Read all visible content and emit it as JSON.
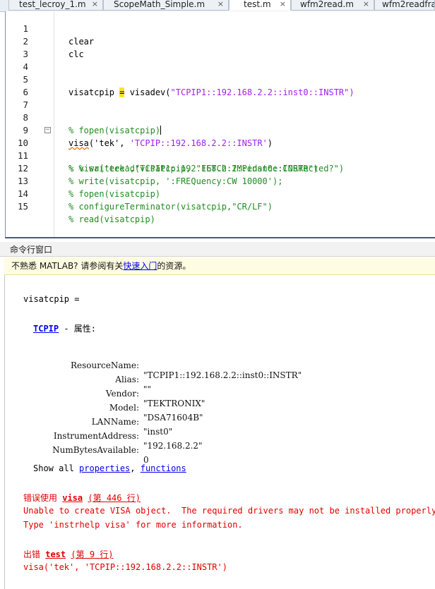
{
  "tabs": [
    {
      "label": "test_lecroy_1.m",
      "close": "×"
    },
    {
      "label": "ScopeMath_Simple.m",
      "close": "×"
    },
    {
      "label": "test.m",
      "close": "×"
    },
    {
      "label": "wfm2read.m",
      "close": "×"
    },
    {
      "label": "wfm2readfra",
      "close": ""
    }
  ],
  "editor": {
    "lines": [
      {
        "n": "1",
        "a": "clear",
        "b": "",
        "c": "",
        "d": ""
      },
      {
        "n": "2",
        "a": "clc",
        "b": "",
        "c": "",
        "d": ""
      },
      {
        "n": "3",
        "a": "",
        "b": "",
        "c": "",
        "d": ""
      },
      {
        "n": "4",
        "a": "",
        "b": "",
        "c": "",
        "d": ""
      },
      {
        "n": "5",
        "a": "visatcpip ",
        "b": "=",
        "c": " visadev(",
        "d": "\"TCPIP1::192.168.2.2::inst0::INSTR\")"
      },
      {
        "n": "6",
        "a": "",
        "b": "",
        "c": "",
        "d": ""
      },
      {
        "n": "7",
        "a": "",
        "b": "",
        "c": "",
        "d": ""
      },
      {
        "n": "8",
        "a": "% fopen(visatcpip)",
        "b": "",
        "c": "",
        "d": ""
      },
      {
        "n": "9",
        "a": "visa",
        "b": "('tek', ",
        "c": "'TCPIP::192.168.2.2::INSTR'",
        "d": ")"
      },
      {
        "n": "10",
        "a": "% visa('tek',\"TCPIP1::192.168.2.2::inst0::INSTR\")",
        "b": "",
        "c": "",
        "d": ""
      },
      {
        "n": "11",
        "a": "% % writeread(visatcpip, \"FETCh:IMPedance:CORRected?\")",
        "b": "",
        "c": "",
        "d": ""
      },
      {
        "n": "12",
        "a": "% write(visatcpip, ':FREQuency:CW 10000');",
        "b": "",
        "c": "",
        "d": ""
      },
      {
        "n": "13",
        "a": "% fopen(visatcpip)",
        "b": "",
        "c": "",
        "d": ""
      },
      {
        "n": "14",
        "a": "% configureTerminator(visatcpip,\"CR/LF\")",
        "b": "",
        "c": "",
        "d": ""
      },
      {
        "n": "15",
        "a": "% read(visatcpip)",
        "b": "",
        "c": "",
        "d": ""
      }
    ],
    "fold_symbol": "−"
  },
  "command_window": {
    "title": "命令行窗口",
    "notice_pre": "不熟悉 MATLAB? 请参阅有关",
    "notice_link": "快速入门",
    "notice_post": "的资源。",
    "var_line": "visatcpip =",
    "class_link": "TCPIP",
    "class_suffix": " - 属性:",
    "properties": [
      {
        "name": "ResourceName:",
        "value": "\"TCPIP1::192.168.2.2::inst0::INSTR\""
      },
      {
        "name": "Alias:",
        "value": "\"\""
      },
      {
        "name": "Vendor:",
        "value": "\"TEKTRONIX\""
      },
      {
        "name": "Model:",
        "value": "\"DSA71604B\""
      },
      {
        "name": "LANName:",
        "value": "\"inst0\""
      },
      {
        "name": "InstrumentAddress:",
        "value": "\"192.168.2.2\""
      },
      {
        "name": "NumBytesAvailable:",
        "value": "0"
      }
    ],
    "show_all": "Show all ",
    "properties_link": "properties",
    "comma": ", ",
    "functions_link": "functions",
    "error1_pre": "错误使用 ",
    "error1_func": "visa",
    "error1_loc": "(第 446 行)",
    "error1_msg1": "Unable to create VISA object.  The required drivers may not be installed properly.",
    "error1_msg2": "Type 'instrhelp visa' for more information.",
    "error2_pre": "出错 ",
    "error2_func": "test",
    "error2_loc": "(第 9 行)",
    "error2_code": "visa('tek', 'TCPIP::192.168.2.2::INSTR')"
  }
}
